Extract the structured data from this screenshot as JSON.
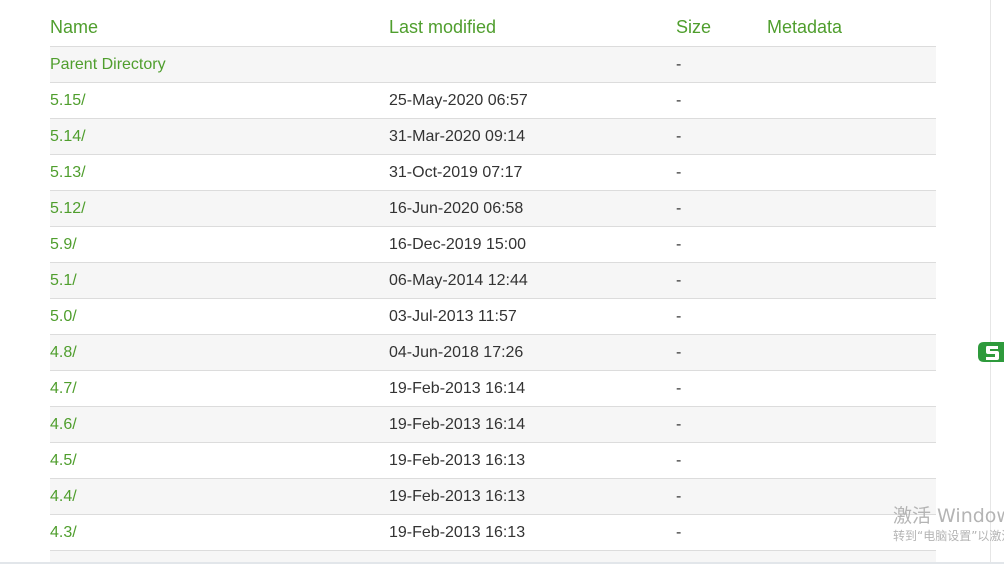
{
  "columns": {
    "name": "Name",
    "last_modified": "Last modified",
    "size": "Size",
    "metadata": "Metadata"
  },
  "rows": [
    {
      "name": "Parent Directory",
      "modified": "",
      "size": "-",
      "metadata": ""
    },
    {
      "name": "5.15/",
      "modified": "25-May-2020 06:57",
      "size": "-",
      "metadata": ""
    },
    {
      "name": "5.14/",
      "modified": "31-Mar-2020 09:14",
      "size": "-",
      "metadata": ""
    },
    {
      "name": "5.13/",
      "modified": "31-Oct-2019 07:17",
      "size": "-",
      "metadata": ""
    },
    {
      "name": "5.12/",
      "modified": "16-Jun-2020 06:58",
      "size": "-",
      "metadata": ""
    },
    {
      "name": "5.9/",
      "modified": "16-Dec-2019 15:00",
      "size": "-",
      "metadata": ""
    },
    {
      "name": "5.1/",
      "modified": "06-May-2014 12:44",
      "size": "-",
      "metadata": ""
    },
    {
      "name": "5.0/",
      "modified": "03-Jul-2013 11:57",
      "size": "-",
      "metadata": ""
    },
    {
      "name": "4.8/",
      "modified": "04-Jun-2018 17:26",
      "size": "-",
      "metadata": ""
    },
    {
      "name": "4.7/",
      "modified": "19-Feb-2013 16:14",
      "size": "-",
      "metadata": ""
    },
    {
      "name": "4.6/",
      "modified": "19-Feb-2013 16:14",
      "size": "-",
      "metadata": ""
    },
    {
      "name": "4.5/",
      "modified": "19-Feb-2013 16:13",
      "size": "-",
      "metadata": ""
    },
    {
      "name": "4.4/",
      "modified": "19-Feb-2013 16:13",
      "size": "-",
      "metadata": ""
    },
    {
      "name": "4.3/",
      "modified": "19-Feb-2013 16:13",
      "size": "-",
      "metadata": ""
    },
    {
      "name": "",
      "modified": "",
      "size": "",
      "metadata": ""
    }
  ],
  "overlay": {
    "ime_icon": "sogou-ime-icon",
    "watermark_title": "激活 Windows",
    "watermark_subtitle": "转到“电脑设置”以激活 Windows。"
  },
  "colors": {
    "accent": "#4f9e2d",
    "text": "#333333",
    "row_alt": "#f6f6f6",
    "divider": "#dcdcdc",
    "watermark": "#b4b4b4"
  }
}
